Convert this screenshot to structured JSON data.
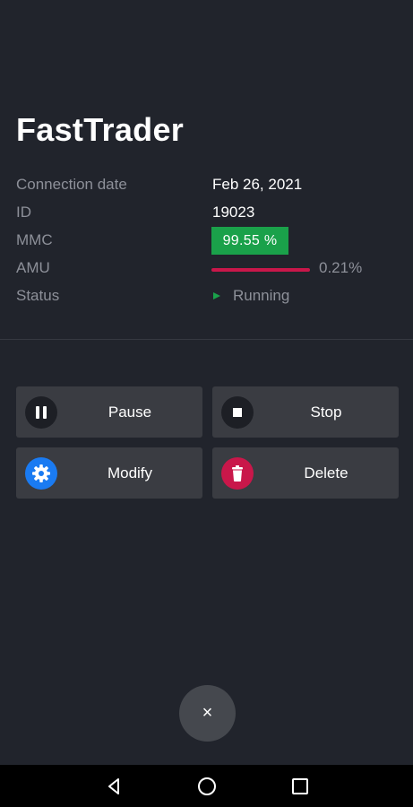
{
  "app": {
    "title": "FastTrader"
  },
  "info": {
    "connection_date": {
      "label": "Connection date",
      "value": "Feb 26, 2021"
    },
    "id": {
      "label": "ID",
      "value": "19023"
    },
    "mmc": {
      "label": "MMC",
      "value": "99.55 %"
    },
    "amu": {
      "label": "AMU",
      "value": "0.21%",
      "fraction": 0.0021
    },
    "status": {
      "label": "Status",
      "value": "Running",
      "icon": "play-icon"
    }
  },
  "actions": {
    "pause": {
      "label": "Pause",
      "icon": "pause-icon"
    },
    "stop": {
      "label": "Stop",
      "icon": "stop-icon"
    },
    "modify": {
      "label": "Modify",
      "icon": "gear-icon"
    },
    "delete": {
      "label": "Delete",
      "icon": "trash-icon"
    }
  },
  "fab": {
    "label": "×",
    "icon": "close-icon"
  },
  "navbar": {
    "back": "back-icon",
    "home": "home-icon",
    "recents": "recents-icon"
  },
  "colors": {
    "background": "#21242c",
    "button": "#3a3c42",
    "success": "#1aa14a",
    "danger": "#c9174a",
    "accent": "#1a7bf2",
    "muted_text": "#8d9099"
  }
}
